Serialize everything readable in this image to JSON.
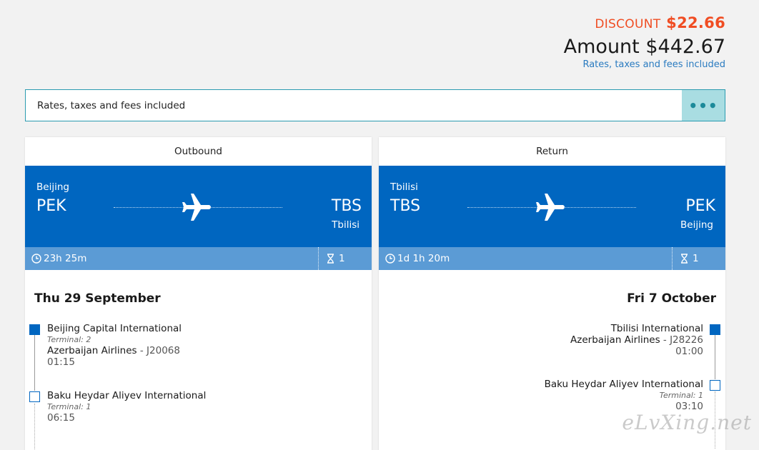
{
  "pricing": {
    "discount_label": "DISCOUNT",
    "discount_amount": "$22.66",
    "amount_label": "Amount $442.67",
    "rates_note": "Rates, taxes and fees included"
  },
  "notice": {
    "text": "Rates, taxes and fees included",
    "more_button": "•••"
  },
  "outbound": {
    "title": "Outbound",
    "from_city": "Beijing",
    "from_code": "PEK",
    "to_code": "TBS",
    "to_city": "Tbilisi",
    "duration": "23h 25m",
    "stops": "1",
    "date": "Thu 29 September",
    "legs": [
      {
        "airport": "Beijing Capital International",
        "terminal": "Terminal: 2",
        "airline": "Azerbaijan Airlines",
        "flight": " - J20068",
        "time": "01:15"
      },
      {
        "airport": "Baku Heydar Aliyev International",
        "terminal": "Terminal: 1",
        "time": "06:15"
      }
    ]
  },
  "return": {
    "title": "Return",
    "from_city": "Tbilisi",
    "from_code": "TBS",
    "to_code": "PEK",
    "to_city": "Beijing",
    "duration": "1d 1h 20m",
    "stops": "1",
    "date": "Fri 7 October",
    "legs": [
      {
        "airport": "Tbilisi International",
        "airline": "Azerbaijan Airlines",
        "flight": " - J28226",
        "time": "01:00"
      },
      {
        "airport": "Baku Heydar Aliyev International",
        "terminal": "Terminal: 1",
        "time": "03:10"
      }
    ]
  },
  "watermark": "eLvXing.net",
  "icons": {
    "plane": "airplane-icon",
    "clock": "clock-icon",
    "stops": "hourglass-icon"
  },
  "colors": {
    "primary": "#0066c0",
    "stats_bar": "#5b9bd5",
    "discount": "#f04d23",
    "link": "#2a7bc0",
    "button_bg": "#a9dde2"
  }
}
